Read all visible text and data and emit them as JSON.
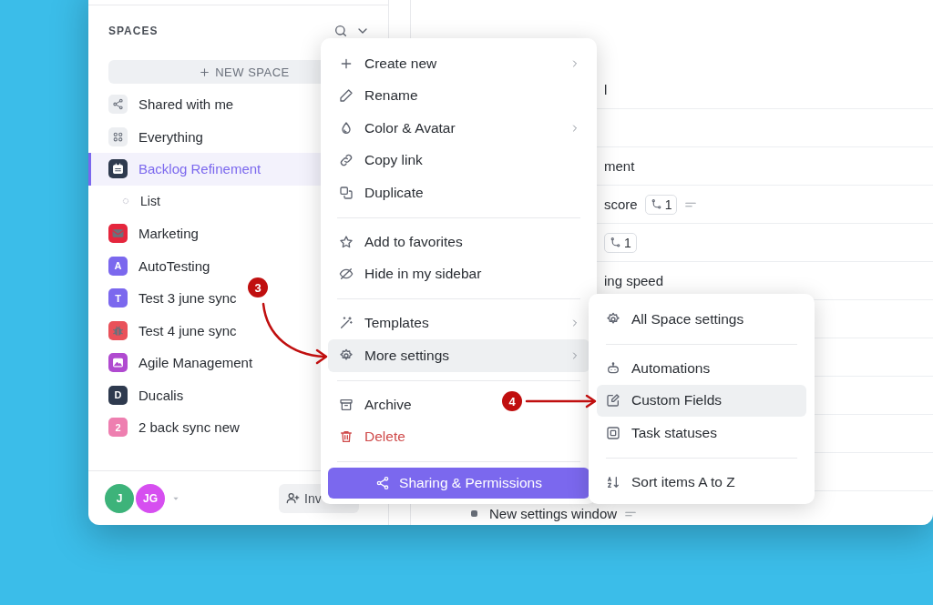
{
  "sidebar": {
    "title": "SPACES",
    "new_space_button": "NEW SPACE",
    "items": [
      {
        "label": "Shared with me",
        "kind": "icon",
        "color": "#eceef1",
        "selected": false
      },
      {
        "label": "Everything",
        "kind": "icon",
        "color": "#eceef1",
        "selected": false
      },
      {
        "label": "Backlog Refinement",
        "kind": "icon",
        "color": "#2e3a4e",
        "selected": true,
        "children": [
          {
            "label": "List",
            "selected": false
          }
        ]
      },
      {
        "label": "Marketing",
        "kind": "icon",
        "color": "#e5263d",
        "selected": false
      },
      {
        "label": "AutoTesting",
        "kind": "letter",
        "letter": "A",
        "color": "#7b68ee",
        "selected": false
      },
      {
        "label": "Test 3 june sync",
        "kind": "letter",
        "letter": "T",
        "color": "#7b68ee",
        "selected": false
      },
      {
        "label": "Test 4 june sync",
        "kind": "icon",
        "color": "#e9515a",
        "selected": false
      },
      {
        "label": "Agile Management",
        "kind": "icon",
        "color": "#b04ad0",
        "selected": false
      },
      {
        "label": "Ducalis",
        "kind": "letter",
        "letter": "D",
        "color": "#2e3a4e",
        "selected": false
      },
      {
        "label": "2 back sync new",
        "kind": "letter",
        "letter": "2",
        "color": "#ee7fb0",
        "selected": false
      }
    ],
    "footer": {
      "avatars": [
        {
          "initials": "J",
          "color": "#3db37a"
        },
        {
          "initials": "JG",
          "color": "#d64ff0"
        }
      ],
      "invite_button": "Inv"
    }
  },
  "main": {
    "rows": [
      {
        "kind": "cut",
        "text": "l"
      },
      {
        "kind": "empty"
      },
      {
        "kind": "cut",
        "text": "ment"
      },
      {
        "kind": "cut",
        "text": "score",
        "subtasks": "1",
        "description": true
      },
      {
        "kind": "cut",
        "subtasks": "1"
      },
      {
        "kind": "cut",
        "text": "ing speed"
      },
      {
        "kind": "empty"
      },
      {
        "kind": "empty"
      },
      {
        "kind": "empty"
      },
      {
        "kind": "empty"
      },
      {
        "kind": "empty"
      },
      {
        "kind": "full",
        "text": "New settings window",
        "description": true
      }
    ]
  },
  "context_menu": {
    "groups": [
      [
        {
          "label": "Create new",
          "submenu": true,
          "selected": false,
          "kind": "normal"
        },
        {
          "label": "Rename",
          "submenu": false,
          "selected": false,
          "kind": "normal"
        },
        {
          "label": "Color & Avatar",
          "submenu": true,
          "selected": false,
          "kind": "normal"
        },
        {
          "label": "Copy link",
          "submenu": false,
          "selected": false,
          "kind": "normal"
        },
        {
          "label": "Duplicate",
          "submenu": false,
          "selected": false,
          "kind": "normal"
        }
      ],
      [
        {
          "label": "Add to favorites",
          "submenu": false,
          "selected": false,
          "kind": "normal"
        },
        {
          "label": "Hide in my sidebar",
          "submenu": false,
          "selected": false,
          "kind": "normal"
        }
      ],
      [
        {
          "label": "Templates",
          "submenu": true,
          "selected": false,
          "kind": "normal"
        },
        {
          "label": "More settings",
          "submenu": true,
          "selected": true,
          "kind": "normal"
        }
      ],
      [
        {
          "label": "Archive",
          "submenu": false,
          "selected": false,
          "kind": "normal"
        },
        {
          "label": "Delete",
          "submenu": false,
          "selected": false,
          "kind": "danger"
        }
      ]
    ],
    "share_button": "Sharing & Permissions"
  },
  "submenu": {
    "groups": [
      [
        {
          "label": "All Space settings",
          "selected": false
        }
      ],
      [
        {
          "label": "Automations",
          "selected": false
        },
        {
          "label": "Custom Fields",
          "selected": true
        },
        {
          "label": "Task statuses",
          "selected": false
        }
      ],
      [
        {
          "label": "Sort items A to Z",
          "selected": false
        }
      ]
    ]
  },
  "annotations": [
    {
      "number": "3"
    },
    {
      "number": "4"
    }
  ]
}
